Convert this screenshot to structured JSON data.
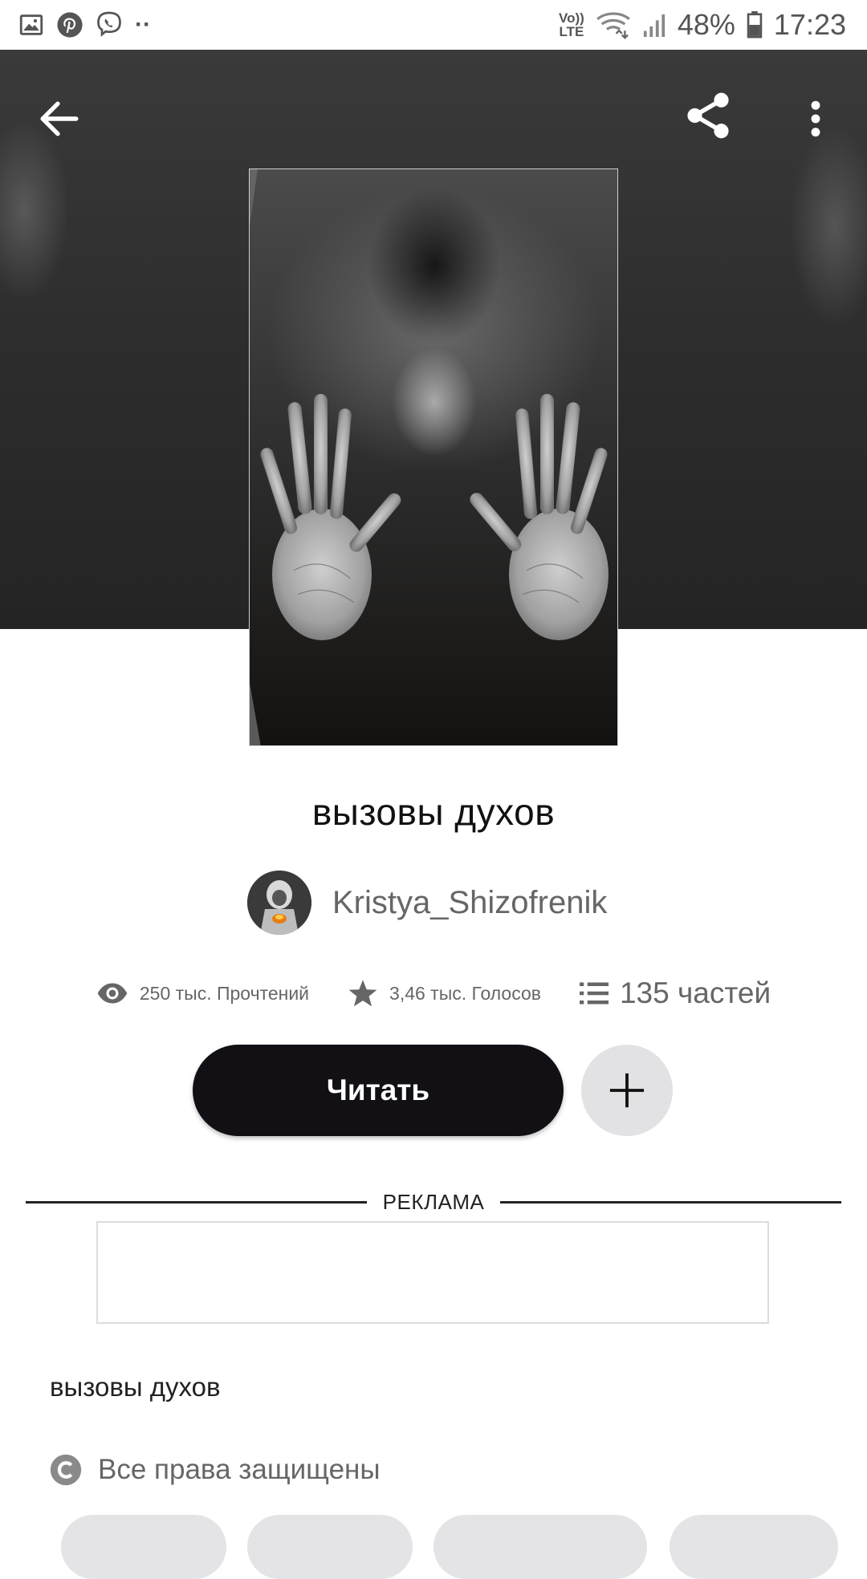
{
  "status_bar": {
    "network_label_top": "Vo))",
    "network_label_bottom": "LTE",
    "battery": "48%",
    "time": "17:23",
    "more_dots": "··"
  },
  "story": {
    "title": "вызовы духов",
    "author": "Kristya_Shizofrenik",
    "stats": {
      "reads": "250 тыс. Прочтений",
      "votes": "3,46 тыс. Голосов",
      "parts": "135 частей"
    },
    "read_label": "Читать",
    "description": "вызовы духов",
    "copyright": "Все права защищены"
  },
  "ad": {
    "label": "РЕКЛАМА"
  },
  "colors": {
    "primary_button": "#121014",
    "secondary_button": "#e2e1e3",
    "hero_background": "#2c2c2c"
  },
  "icons": [
    "back-arrow-icon",
    "share-icon",
    "more-vertical-icon",
    "eye-icon",
    "star-icon",
    "list-icon",
    "plus-icon",
    "copyright-icon"
  ]
}
